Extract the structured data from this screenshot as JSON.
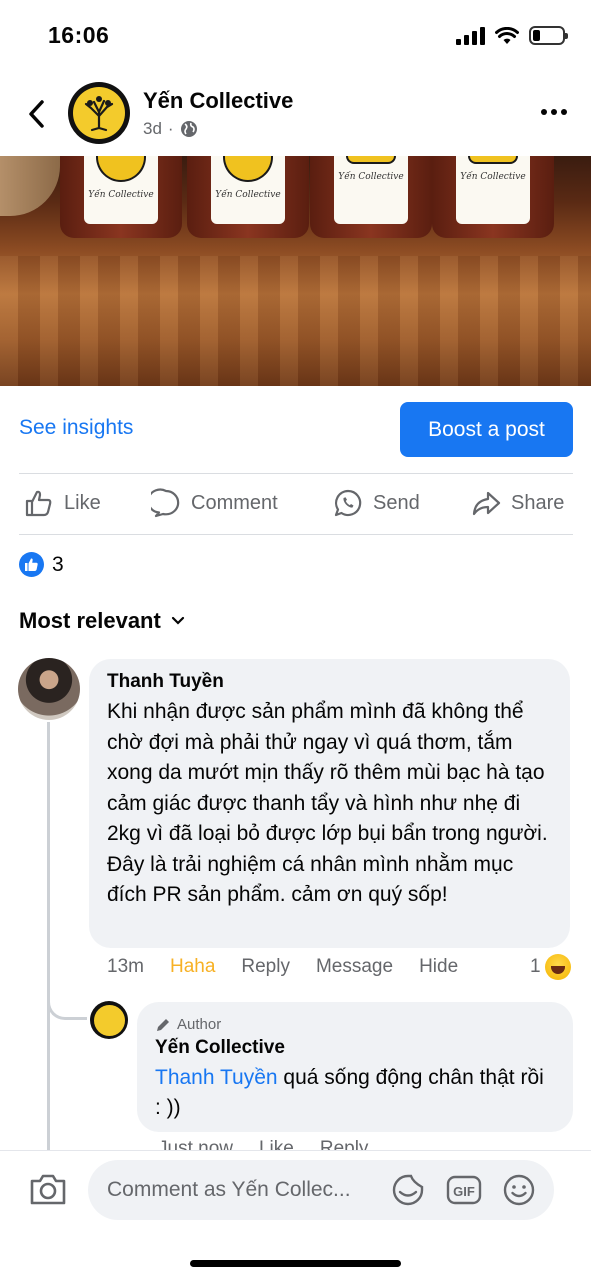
{
  "status_bar": {
    "time": "16:06",
    "battery_level": 0.25
  },
  "header": {
    "page_name": "Yến Collective",
    "post_age": "3d",
    "separator": "·",
    "audience_icon": "globe-icon"
  },
  "post": {
    "photo_label_text": "Yến Collective",
    "insights_link": "See insights",
    "boost_button": "Boost a post"
  },
  "actions": {
    "like": "Like",
    "comment": "Comment",
    "send": "Send",
    "share": "Share"
  },
  "reactions": {
    "count": "3",
    "icon": "like-icon"
  },
  "sort": {
    "label": "Most relevant"
  },
  "comment": {
    "author": "Thanh Tuyền",
    "text": "Khi nhận được sản phẩm mình đã không thể chờ đợi mà phải thử ngay vì quá thơm, tắm xong da mướt mịn thấy rõ thêm mùi bạc hà tạo cảm giác được thanh tẩy và hình như nhẹ đi 2kg vì đã loại bỏ được lớp bụi bẩn trong người.\nĐây là trải nghiệm cá nhân mình nhằm mục đích PR sản phẩm. cảm ơn quý sốp!",
    "time": "13m",
    "reaction_label": "Haha",
    "reply_label": "Reply",
    "message_label": "Message",
    "hide_label": "Hide",
    "reaction_count": "1",
    "reaction_icon": "haha-icon"
  },
  "reply": {
    "badge": "Author",
    "author": "Yến Collective",
    "mention": "Thanh Tuyền",
    "text": " quá sống động chân thật rồi : ))",
    "time": "Just now",
    "like_label": "Like",
    "reply_label": "Reply"
  },
  "composer": {
    "placeholder": "Comment as Yến Collec...",
    "icons": [
      "camera-icon",
      "sticker-icon",
      "gif-icon",
      "emoji-icon"
    ]
  },
  "colors": {
    "accent": "#1877f2",
    "haha": "#f7b125",
    "bubble": "#f0f2f5",
    "muted": "#65676b",
    "logo_yellow": "#f3cb2c"
  }
}
